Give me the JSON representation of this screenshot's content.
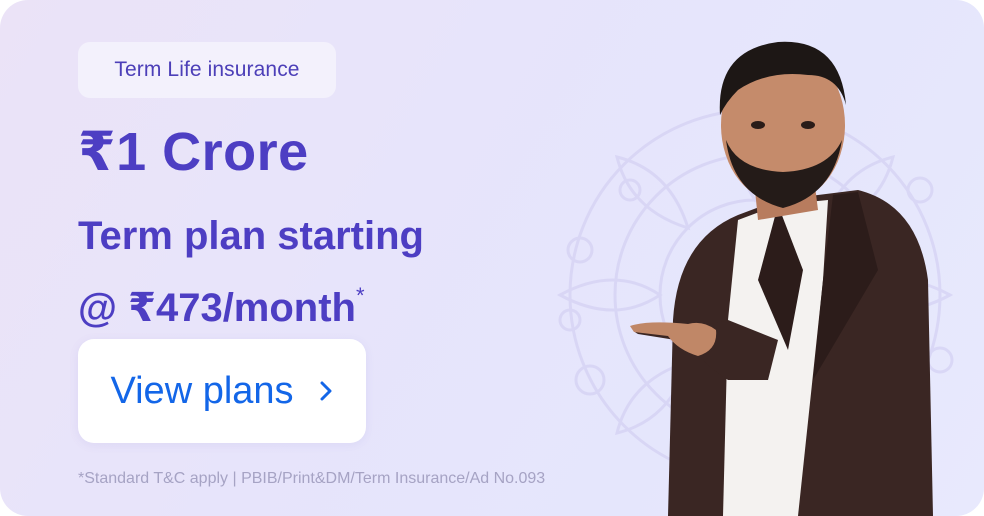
{
  "banner": {
    "badge_label": "Term Life insurance",
    "headline": "₹1 Crore",
    "subline_1": "Term plan starting",
    "subline_2": "@ ₹473/month",
    "subline_asterisk": "*",
    "cta_label": "View plans",
    "cta_icon": "chevron-right-icon",
    "disclaimer": "*Standard T&C apply | PBIB/Print&DM/Term Insurance/Ad No.093"
  },
  "colors": {
    "brand_text": "#4d3ec3",
    "cta_text": "#1366e8",
    "background": "#e7e4fb"
  }
}
